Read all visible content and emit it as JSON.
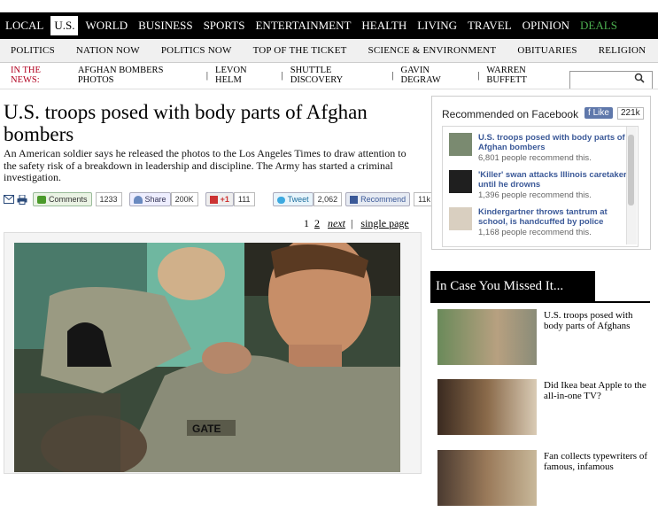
{
  "main_nav": [
    "LOCAL",
    "U.S.",
    "WORLD",
    "BUSINESS",
    "SPORTS",
    "ENTERTAINMENT",
    "HEALTH",
    "LIVING",
    "TRAVEL",
    "OPINION",
    "DEALS"
  ],
  "sub_nav": [
    "POLITICS",
    "NATION NOW",
    "POLITICS NOW",
    "TOP OF THE TICKET",
    "SCIENCE & ENVIRONMENT",
    "OBITUARIES",
    "RELIGION"
  ],
  "in_the_news": {
    "label": "IN THE NEWS:",
    "links": [
      "AFGHAN BOMBERS PHOTOS",
      "LEVON HELM",
      "SHUTTLE DISCOVERY",
      "GAVIN DEGRAW",
      "WARREN BUFFETT"
    ]
  },
  "article": {
    "headline": "U.S. troops posed with body parts of Afghan bombers",
    "dek": "An American soldier says he released the photos to the Los Angeles Times to draw attention to the safety risk of a breakdown in leadership and discipline. The Army has started a criminal investigation."
  },
  "social": {
    "comments_label": "Comments",
    "comments_count": "1233",
    "share_label": "Share",
    "share_count": "200K",
    "gplus_label": "+1",
    "gplus_count": "111",
    "tweet_label": "Tweet",
    "tweet_count": "2,062",
    "recommend_label": "Recommend",
    "recommend_count": "11k"
  },
  "pager": {
    "page1": "1",
    "page2": "2",
    "next": "next",
    "single": "single page"
  },
  "photo": {
    "name_tape": "GATE"
  },
  "facebook": {
    "title": "Recommended on Facebook",
    "like_label": "Like",
    "like_count": "221k",
    "items": [
      {
        "title": "U.S. troops posed with body parts of Afghan bombers",
        "meta": "6,801 people recommend this."
      },
      {
        "title": "'Killer' swan attacks Illinois caretaker until he drowns",
        "meta": "1,396 people recommend this."
      },
      {
        "title": "Kindergartner throws tantrum at school, is handcuffed by police",
        "meta": "1,168 people recommend this."
      }
    ]
  },
  "icym": {
    "title": "In Case You Missed It...",
    "items": [
      {
        "title": "U.S. troops posed with body parts of Afghans"
      },
      {
        "title": "Did Ikea beat Apple to the all-in-one TV?"
      },
      {
        "title": "Fan collects typewriters of famous, infamous"
      }
    ]
  },
  "colors": {
    "nav_bg": "#000000",
    "news_label": "#b1001f",
    "fb_blue": "#3b5998",
    "deals_green": "#4caf50"
  }
}
